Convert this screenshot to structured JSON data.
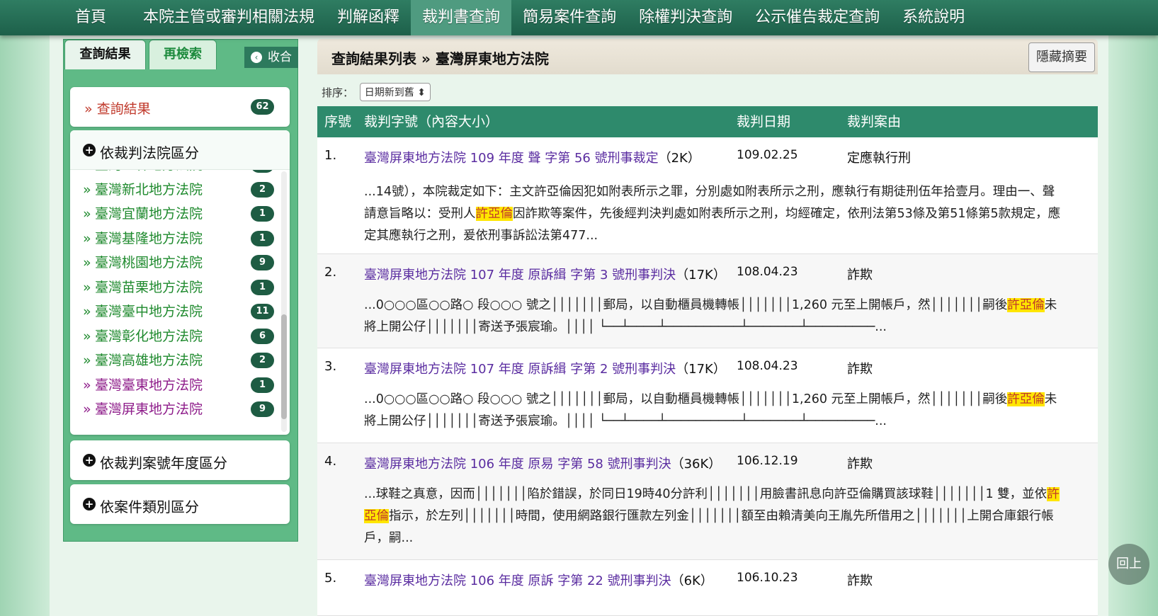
{
  "nav": {
    "items": [
      {
        "label": "首頁"
      },
      {
        "label": "本院主管或審判相關法規"
      },
      {
        "label": "判解函釋"
      },
      {
        "label": "裁判書查詢"
      },
      {
        "label": "簡易案件查詢"
      },
      {
        "label": "除權判決查詢"
      },
      {
        "label": "公示催告裁定查詢"
      },
      {
        "label": "系統說明"
      }
    ],
    "active_index": 3
  },
  "sidebar": {
    "tab_results": "查詢結果",
    "tab_research": "再檢索",
    "collapse_label": "收合",
    "collapse_icon": "chevron-left-icon",
    "result_link": {
      "label": "查詢結果",
      "count": "62"
    },
    "by_court": {
      "title": "依裁判法院區分",
      "partial_item": "臺灣士林地方法院",
      "items": [
        {
          "label": "臺灣新北地方法院",
          "count": "2"
        },
        {
          "label": "臺灣宜蘭地方法院",
          "count": "1"
        },
        {
          "label": "臺灣基隆地方法院",
          "count": "1"
        },
        {
          "label": "臺灣桃園地方法院",
          "count": "9"
        },
        {
          "label": "臺灣苗栗地方法院",
          "count": "1"
        },
        {
          "label": "臺灣臺中地方法院",
          "count": "11"
        },
        {
          "label": "臺灣彰化地方法院",
          "count": "6"
        },
        {
          "label": "臺灣高雄地方法院",
          "count": "2"
        },
        {
          "label": "臺灣臺東地方法院",
          "count": "1"
        },
        {
          "label": "臺灣屏東地方法院",
          "count": "9"
        }
      ]
    },
    "by_year": {
      "title": "依裁判案號年度區分"
    },
    "by_type": {
      "title": "依案件類別區分"
    }
  },
  "content": {
    "title": "查詢結果列表 » 臺灣屏東地方法院",
    "hide_summary": "隱藏摘要",
    "sort_label": "排序：",
    "sort_value": "日期新到舊 ⬍",
    "columns": [
      "序號",
      "裁判字號（內容大小）",
      "裁判日期",
      "裁判案由"
    ],
    "rows": [
      {
        "no": "1.",
        "case": "臺灣屏東地方法院 109 年度 聲 字第 56 號刑事裁定",
        "size": "（2K）",
        "date": "109.02.25",
        "reason": "定應執行刑",
        "summary_before": "...14號），本院裁定如下：主文許亞倫因犯如附表所示之罪，分別處如附表所示之刑，應執行有期徒刑伍年拾壹月。理由一、聲請意旨略以：受刑人",
        "summary_highlight": "許亞倫",
        "summary_after": "因詐欺等案件，先後經判決判處如附表所示之刑，均經確定，依刑法第53條及第51條第5款規定，應定其應執行之刑，爰依刑事訴訟法第477..."
      },
      {
        "no": "2.",
        "case": "臺灣屏東地方法院 107 年度 原訴緝 字第 3 號刑事判決",
        "size": "（17K）",
        "date": "108.04.23",
        "reason": "詐欺",
        "summary_before": "...0○○○區○○路○ 段○○○ 號之│││││││郵局，以自動櫃員機轉帳│││││││1,260 元至上開帳戶，然│││││││嗣後",
        "summary_highlight": "許亞倫",
        "summary_after": "未將上開公仔│││││││寄送予張宸瑜。││││ └──┴────┴──────────┴───────┴─────────..."
      },
      {
        "no": "3.",
        "case": "臺灣屏東地方法院 107 年度 原訴緝 字第 2 號刑事判決",
        "size": "（17K）",
        "date": "108.04.23",
        "reason": "詐欺",
        "summary_before": "...0○○○區○○路○ 段○○○ 號之│││││││郵局，以自動櫃員機轉帳│││││││1,260 元至上開帳戶，然│││││││嗣後",
        "summary_highlight": "許亞倫",
        "summary_after": "未將上開公仔│││││││寄送予張宸瑜。││││ └──┴────┴──────────┴───────┴─────────..."
      },
      {
        "no": "4.",
        "case": "臺灣屏東地方法院 106 年度 原易 字第 58 號刑事判決",
        "size": "（36K）",
        "date": "106.12.19",
        "reason": "詐欺",
        "summary_before": "...球鞋之真意，因而│││││││陷於錯誤，於同日19時40分許利│││││││用臉書訊息向許亞倫購買該球鞋│││││││1 雙，並依",
        "summary_highlight": "許亞倫",
        "summary_after": "指示，於左列│││││││時間，使用網路銀行匯款左列金│││││││額至由賴清美向王胤先所借用之│││││││上開合庫銀行帳戶，嗣..."
      },
      {
        "no": "5.",
        "case": "臺灣屏東地方法院 106 年度 原訴 字第 22 號刑事判決",
        "size": "（6K）",
        "date": "106.10.23",
        "reason": "詐欺"
      }
    ]
  },
  "back_to_top": "回上",
  "colors": {
    "nav_bg": "#1d604a",
    "nav_active": "#4f9b80",
    "table_head": "#2e8a6c",
    "court_link_green": "#1f8a2e",
    "court_link_purple": "#8e1c8a",
    "case_link": "#5a2ca0",
    "highlight": "#ffe600"
  }
}
